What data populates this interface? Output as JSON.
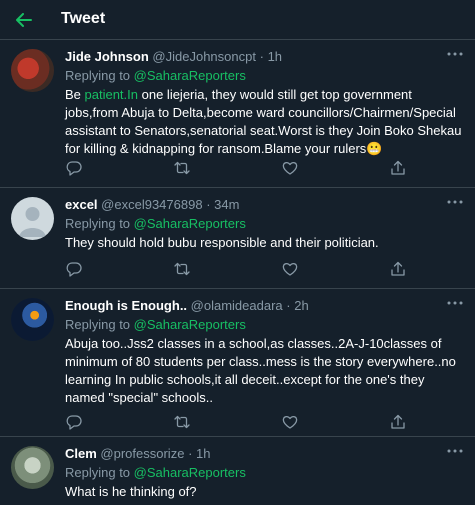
{
  "header": {
    "title": "Tweet"
  },
  "colors": {
    "background": "#15202b",
    "accent": "#17bf63",
    "muted": "#8899a6",
    "divider": "#38444d"
  },
  "tweets": [
    {
      "name": "Jide Johnson",
      "handle": "@JideJohnsoncpt",
      "separator": "·",
      "time": "1h",
      "replying_prefix": "Replying to ",
      "replying_to": "@SaharaReporters",
      "text_prefix": "Be ",
      "text_link": "patient.In",
      "text": " one liejeria, they would still get top government jobs,from Abuja to Delta,become ward councillors/Chairmen/Special assistant to Senators,senatorial seat.Worst is they Join Boko Shekau for killing & kidnapping for ransom.Blame your rulers",
      "emoji": "😬"
    },
    {
      "name": "excel",
      "handle": "@excel93476898",
      "separator": "·",
      "time": "34m",
      "replying_prefix": "Replying to ",
      "replying_to": "@SaharaReporters",
      "text": "They should hold bubu responsible and their politician."
    },
    {
      "name": "Enough is Enough..",
      "handle": "@olamideadara",
      "separator": "·",
      "time": "2h",
      "replying_prefix": "Replying to ",
      "replying_to": "@SaharaReporters",
      "text": "Abuja too..Jss2 classes in a school,as classes..2A-J-10classes of minimum of 80 students per class..mess is the story everywhere..no learning In public schools,it all deceit..except for the one's they named \"special\" schools.."
    },
    {
      "name": "Clem",
      "handle": "@professorize",
      "separator": "·",
      "time": "1h",
      "replying_prefix": "Replying to ",
      "replying_to": "@SaharaReporters",
      "text": "What is he thinking of?"
    }
  ]
}
